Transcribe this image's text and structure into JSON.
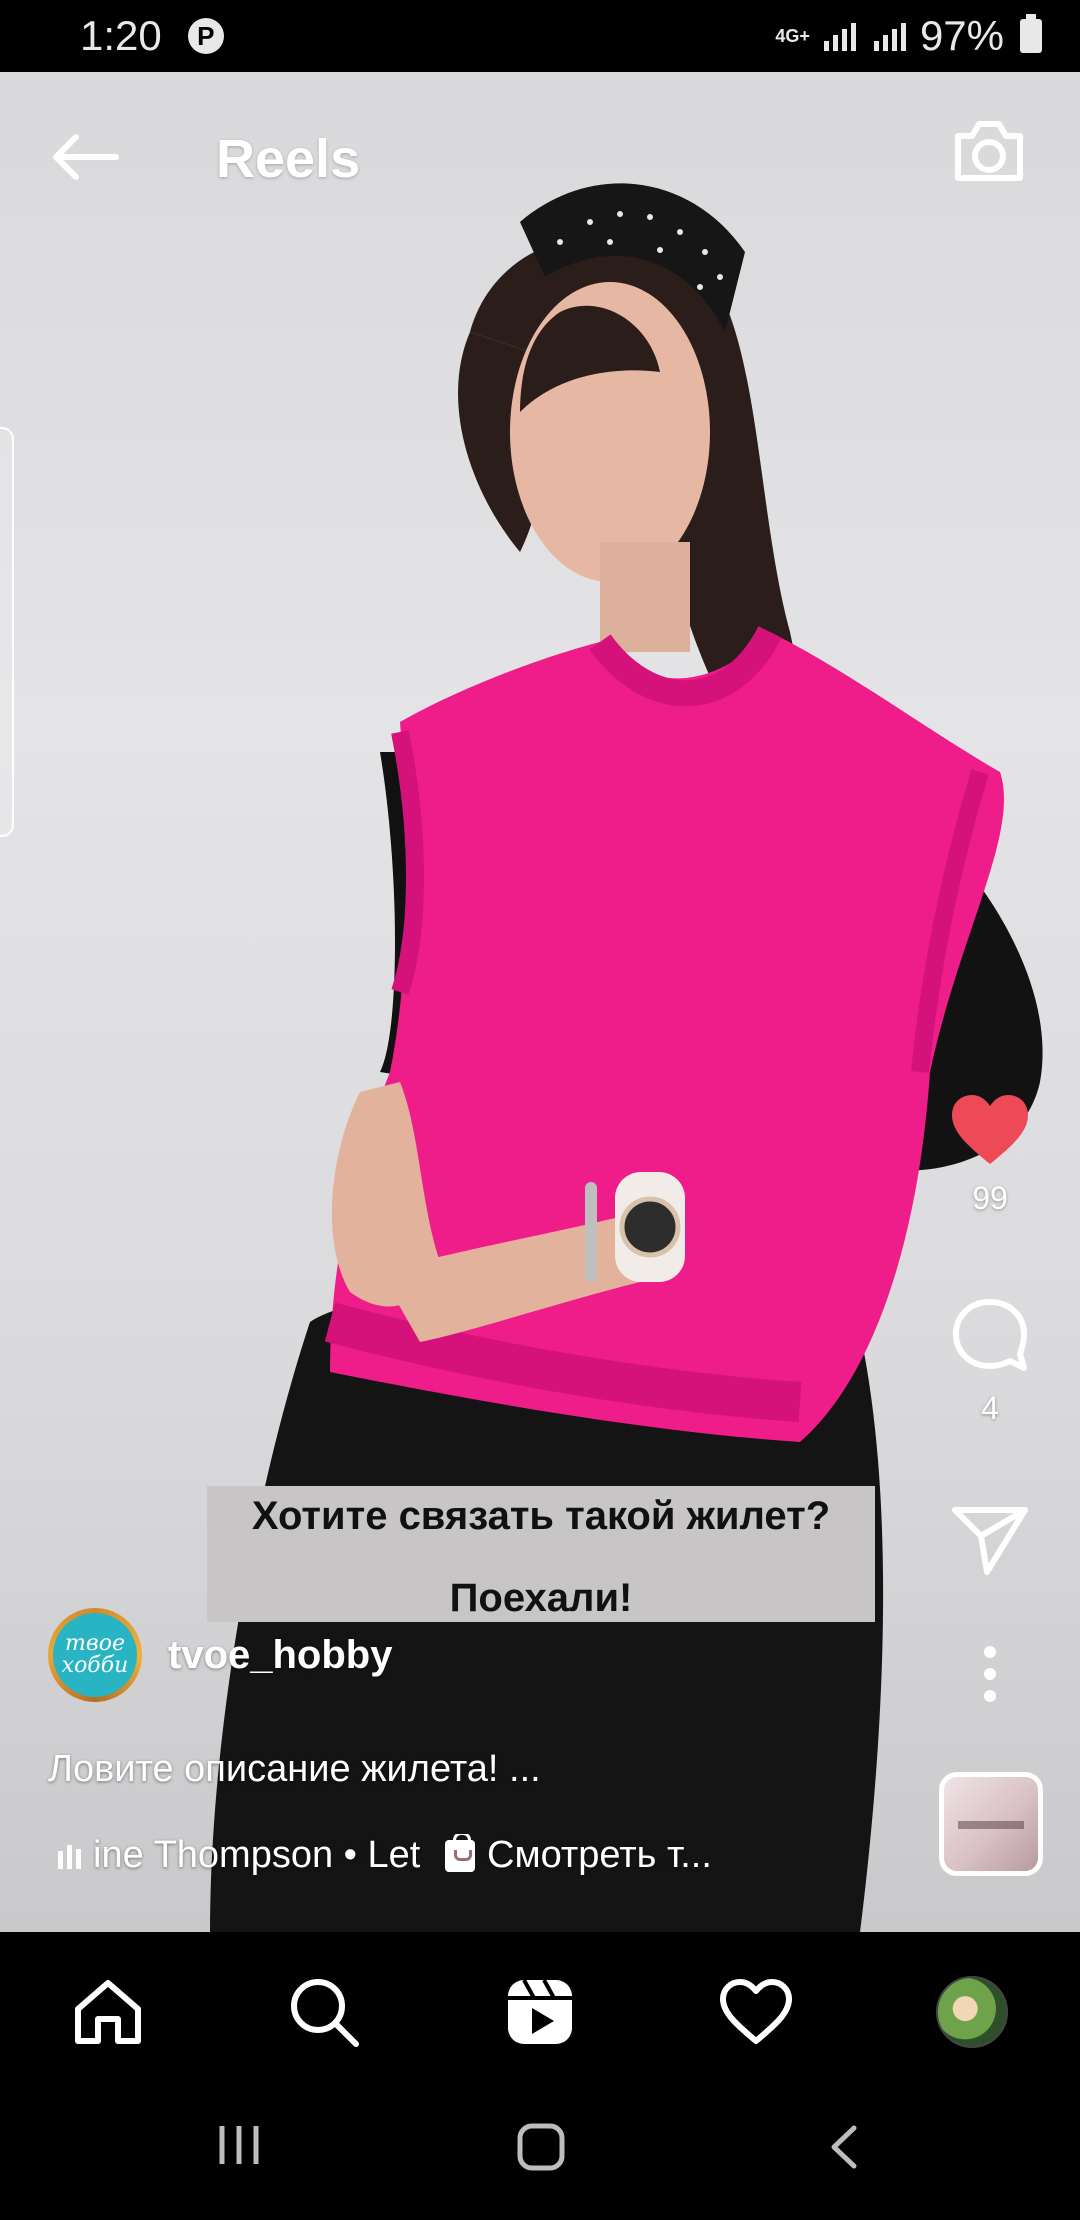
{
  "status_bar": {
    "time": "1:20",
    "notification_icon": "pinterest-icon",
    "network": "4G+",
    "battery": "97%"
  },
  "header": {
    "title": "Reels",
    "back_icon": "arrow-left-icon",
    "camera_icon": "camera-icon"
  },
  "actions": {
    "likes": "99",
    "comments": "4",
    "like_color": "#ed4956"
  },
  "caption_overlay": {
    "line1": "Хотите связать такой жилет?",
    "line2": "Поехали!"
  },
  "author": {
    "username": "tvoe_hobby",
    "avatar_text": "твое хобби"
  },
  "description": "Ловите описание жилета! ...",
  "music": {
    "track": "ine Thompson • Let Her (",
    "shop_label": "Смотреть т..."
  },
  "bottom_nav": [
    "home-icon",
    "search-icon",
    "reels-icon",
    "heart-icon",
    "profile-avatar"
  ],
  "system_nav": [
    "recents-icon",
    "home-button-icon",
    "back-icon"
  ],
  "colors": {
    "sweater": "#ee1d8a",
    "skirt": "#141414",
    "background": "#dcdcdd",
    "accent_red": "#ed4956"
  }
}
